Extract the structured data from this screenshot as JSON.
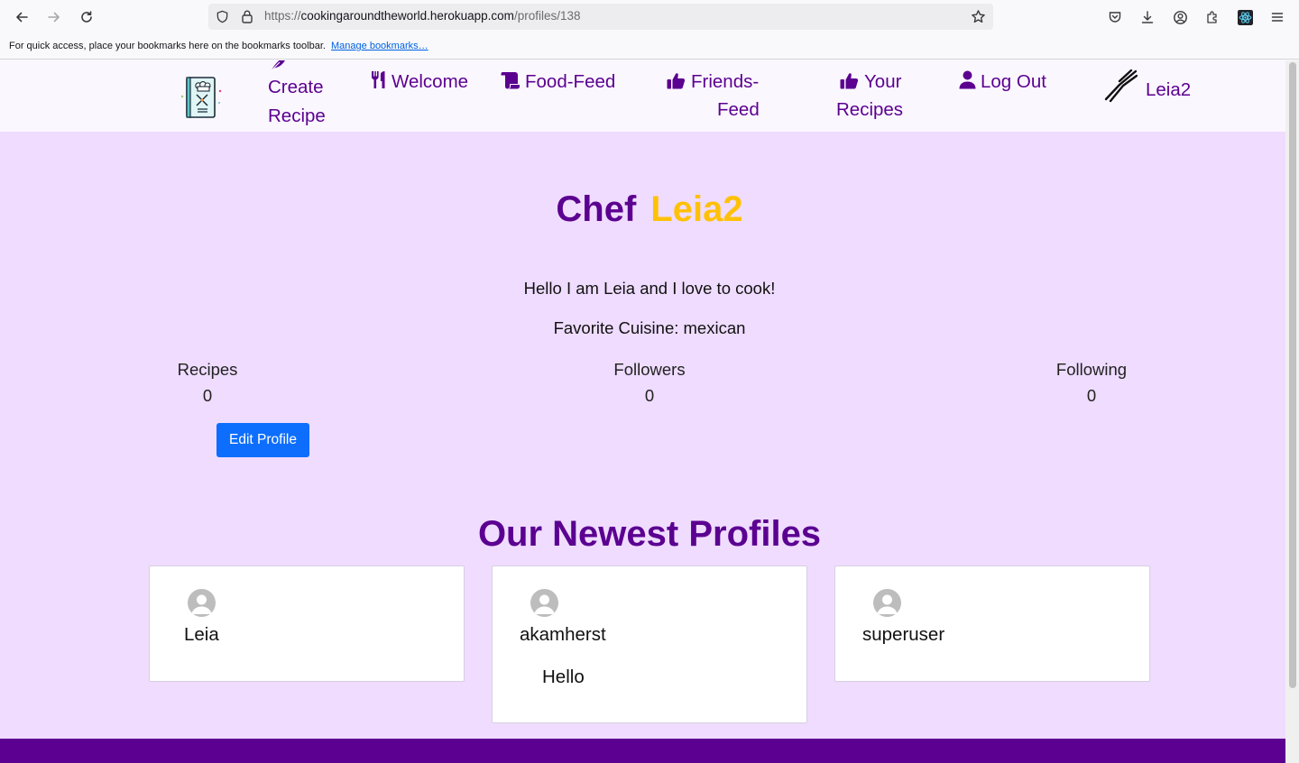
{
  "browser": {
    "url_prefix": "https://",
    "url_domain": "cookingaroundtheworld.herokuapp.com",
    "url_path": "/profiles/138",
    "bookmarks_text": "For quick access, place your bookmarks here on the bookmarks toolbar.",
    "bookmarks_link": "Manage bookmarks…"
  },
  "nav": {
    "create_line1": "Create",
    "create_line2": "Recipe",
    "welcome": "Welcome",
    "food_feed": "Food-Feed",
    "friends_line1": "Friends-",
    "friends_line2": "Feed",
    "your_line1": "Your",
    "your_line2": "Recipes",
    "logout": "Log Out",
    "username": "Leia2"
  },
  "profile": {
    "title_prefix": "Chef",
    "name": "Leia2",
    "bio": "Hello I am Leia and I love to cook!",
    "cuisine": "Favorite Cuisine: mexican",
    "stats": {
      "recipes_label": "Recipes",
      "recipes_value": "0",
      "followers_label": "Followers",
      "followers_value": "0",
      "following_label": "Following",
      "following_value": "0"
    },
    "edit_button": "Edit Profile"
  },
  "newest": {
    "title": "Our Newest Profiles",
    "profiles": [
      {
        "name": "Leia",
        "bio": ""
      },
      {
        "name": "akamherst",
        "bio": "Hello"
      },
      {
        "name": "superuser",
        "bio": ""
      }
    ]
  },
  "colors": {
    "brand_purple": "#5b0090",
    "accent_yellow": "#ffc107",
    "page_bg": "#efdcff",
    "button_blue": "#0d6efd"
  }
}
